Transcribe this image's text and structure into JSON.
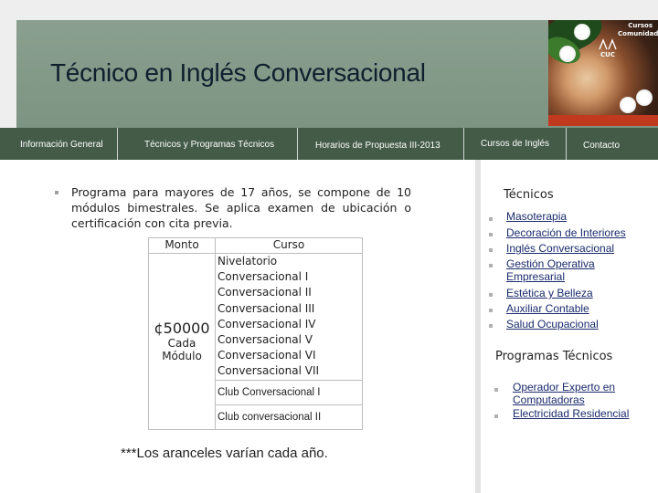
{
  "header": {
    "title": "Técnico en Inglés Conversacional",
    "logo_text": "CUC",
    "photo_caption": [
      "Cursos",
      "Comunidad"
    ]
  },
  "nav": {
    "items": [
      {
        "label": "Información General"
      },
      {
        "label": "Técnicos y Programas Técnicos"
      },
      {
        "label": "Horarios de Propuesta III-2013"
      },
      {
        "label": "Cursos de Inglés"
      },
      {
        "label": "Contacto"
      }
    ]
  },
  "main": {
    "intro": "Programa para mayores de 17 años, se compone de 10 módulos bimestrales. Se aplica examen de ubicación o certificación con cita previa.",
    "table": {
      "col_price": "Monto",
      "col_course": "Curso",
      "price": "¢50000",
      "price_note": [
        "Cada",
        "Módulo"
      ],
      "courses": [
        "Nivelatorio",
        "Conversacional I",
        "Conversacional II",
        "Conversacional III",
        "Conversacional IV",
        "Conversacional V",
        "Conversacional VI",
        "Conversacional VII"
      ],
      "clubs": [
        "Club Conversacional I",
        "Club conversacional II"
      ]
    },
    "note": "***Los aranceles varían cada año."
  },
  "sidebar": {
    "tecnicos_title": "Técnicos",
    "tecnicos": [
      "Masoterapia",
      "Decoración de Interiores",
      "Inglés Conversacional",
      "Gestión Operativa Empresarial",
      "Estética y Belleza",
      "Auxiliar Contable",
      "Salud Ocupacional"
    ],
    "programas_title": "Programas Técnicos",
    "programas": [
      "Operador Experto en Computadoras",
      "Electricidad Residencial"
    ]
  }
}
